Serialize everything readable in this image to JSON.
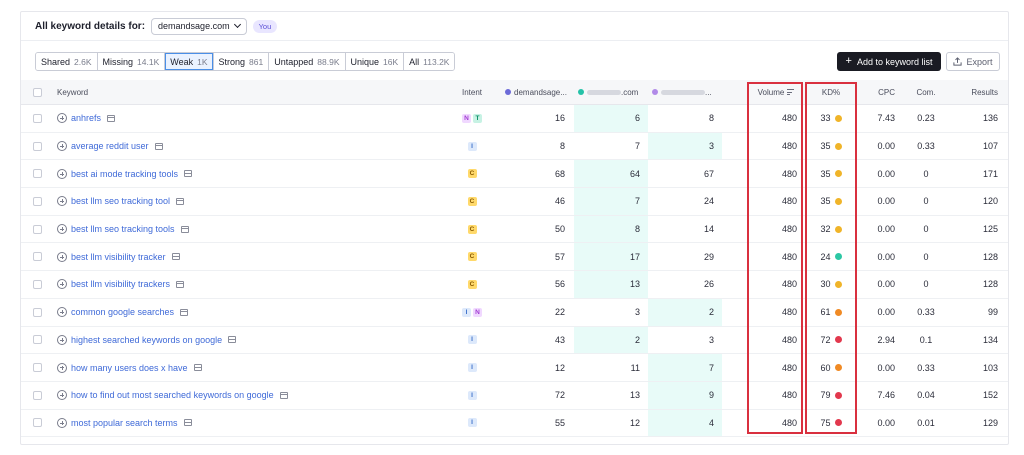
{
  "header": {
    "title": "All keyword details for:",
    "domain": "demandsage.com",
    "badge": "You"
  },
  "filters": [
    {
      "label": "Shared",
      "count": "2.6K",
      "active": false
    },
    {
      "label": "Missing",
      "count": "14.1K",
      "active": false
    },
    {
      "label": "Weak",
      "count": "1K",
      "active": true
    },
    {
      "label": "Strong",
      "count": "861",
      "active": false
    },
    {
      "label": "Untapped",
      "count": "88.9K",
      "active": false
    },
    {
      "label": "Unique",
      "count": "16K",
      "active": false
    },
    {
      "label": "All",
      "count": "113.2K",
      "active": false
    }
  ],
  "actions": {
    "add_label": "Add to keyword list",
    "add_glyph": "+",
    "export_label": "Export"
  },
  "columns": {
    "keyword": "Keyword",
    "intent": "Intent",
    "domain1": "demandsage...",
    "domain2": ".com",
    "domain3": "...",
    "volume": "Volume",
    "kd": "KD%",
    "cpc": "CPC",
    "com": "Com.",
    "results": "Results"
  },
  "colors": {
    "domain1": "#6c6ad8",
    "domain2": "#25c2a8",
    "domain3": "#b18ae8",
    "kd_easy": "#2cc7a4",
    "kd_mid": "#f0b429",
    "kd_hard": "#f08a24",
    "kd_very_hard": "#e2384d",
    "highlight_box": "#d9303f"
  },
  "rows": [
    {
      "keyword": "anhrefs",
      "intent": [
        "N",
        "T"
      ],
      "d1": "16",
      "d2": "6",
      "d3": "8",
      "best": 2,
      "volume": "480",
      "kd": "33",
      "kd_level": "kd_mid",
      "cpc": "7.43",
      "com": "0.23",
      "results": "136"
    },
    {
      "keyword": "average reddit user",
      "intent": [
        "I"
      ],
      "d1": "8",
      "d2": "7",
      "d3": "3",
      "best": 3,
      "volume": "480",
      "kd": "35",
      "kd_level": "kd_mid",
      "cpc": "0.00",
      "com": "0.33",
      "results": "107"
    },
    {
      "keyword": "best ai mode tracking tools",
      "intent": [
        "C"
      ],
      "d1": "68",
      "d2": "64",
      "d3": "67",
      "best": 2,
      "volume": "480",
      "kd": "35",
      "kd_level": "kd_mid",
      "cpc": "0.00",
      "com": "0",
      "results": "171"
    },
    {
      "keyword": "best llm seo tracking tool",
      "intent": [
        "C"
      ],
      "d1": "46",
      "d2": "7",
      "d3": "24",
      "best": 2,
      "volume": "480",
      "kd": "35",
      "kd_level": "kd_mid",
      "cpc": "0.00",
      "com": "0",
      "results": "120"
    },
    {
      "keyword": "best llm seo tracking tools",
      "intent": [
        "C"
      ],
      "d1": "50",
      "d2": "8",
      "d3": "14",
      "best": 2,
      "volume": "480",
      "kd": "32",
      "kd_level": "kd_mid",
      "cpc": "0.00",
      "com": "0",
      "results": "125"
    },
    {
      "keyword": "best llm visibility tracker",
      "intent": [
        "C"
      ],
      "d1": "57",
      "d2": "17",
      "d3": "29",
      "best": 2,
      "volume": "480",
      "kd": "24",
      "kd_level": "kd_easy",
      "cpc": "0.00",
      "com": "0",
      "results": "128"
    },
    {
      "keyword": "best llm visibility trackers",
      "intent": [
        "C"
      ],
      "d1": "56",
      "d2": "13",
      "d3": "26",
      "best": 2,
      "volume": "480",
      "kd": "30",
      "kd_level": "kd_mid",
      "cpc": "0.00",
      "com": "0",
      "results": "128"
    },
    {
      "keyword": "common google searches",
      "intent": [
        "I",
        "N"
      ],
      "d1": "22",
      "d2": "3",
      "d3": "2",
      "best": 3,
      "volume": "480",
      "kd": "61",
      "kd_level": "kd_hard",
      "cpc": "0.00",
      "com": "0.33",
      "results": "99"
    },
    {
      "keyword": "highest searched keywords on google",
      "intent": [
        "I"
      ],
      "d1": "43",
      "d2": "2",
      "d3": "3",
      "best": 2,
      "volume": "480",
      "kd": "72",
      "kd_level": "kd_very_hard",
      "cpc": "2.94",
      "com": "0.1",
      "results": "134"
    },
    {
      "keyword": "how many users does x have",
      "intent": [
        "I"
      ],
      "d1": "12",
      "d2": "11",
      "d3": "7",
      "best": 3,
      "volume": "480",
      "kd": "60",
      "kd_level": "kd_hard",
      "cpc": "0.00",
      "com": "0.33",
      "results": "103"
    },
    {
      "keyword": "how to find out most searched keywords on google",
      "intent": [
        "I"
      ],
      "d1": "72",
      "d2": "13",
      "d3": "9",
      "best": 3,
      "volume": "480",
      "kd": "79",
      "kd_level": "kd_very_hard",
      "cpc": "7.46",
      "com": "0.04",
      "results": "152"
    },
    {
      "keyword": "most popular search terms",
      "intent": [
        "I"
      ],
      "d1": "55",
      "d2": "12",
      "d3": "4",
      "best": 3,
      "volume": "480",
      "kd": "75",
      "kd_level": "kd_very_hard",
      "cpc": "0.00",
      "com": "0.01",
      "results": "129"
    }
  ]
}
